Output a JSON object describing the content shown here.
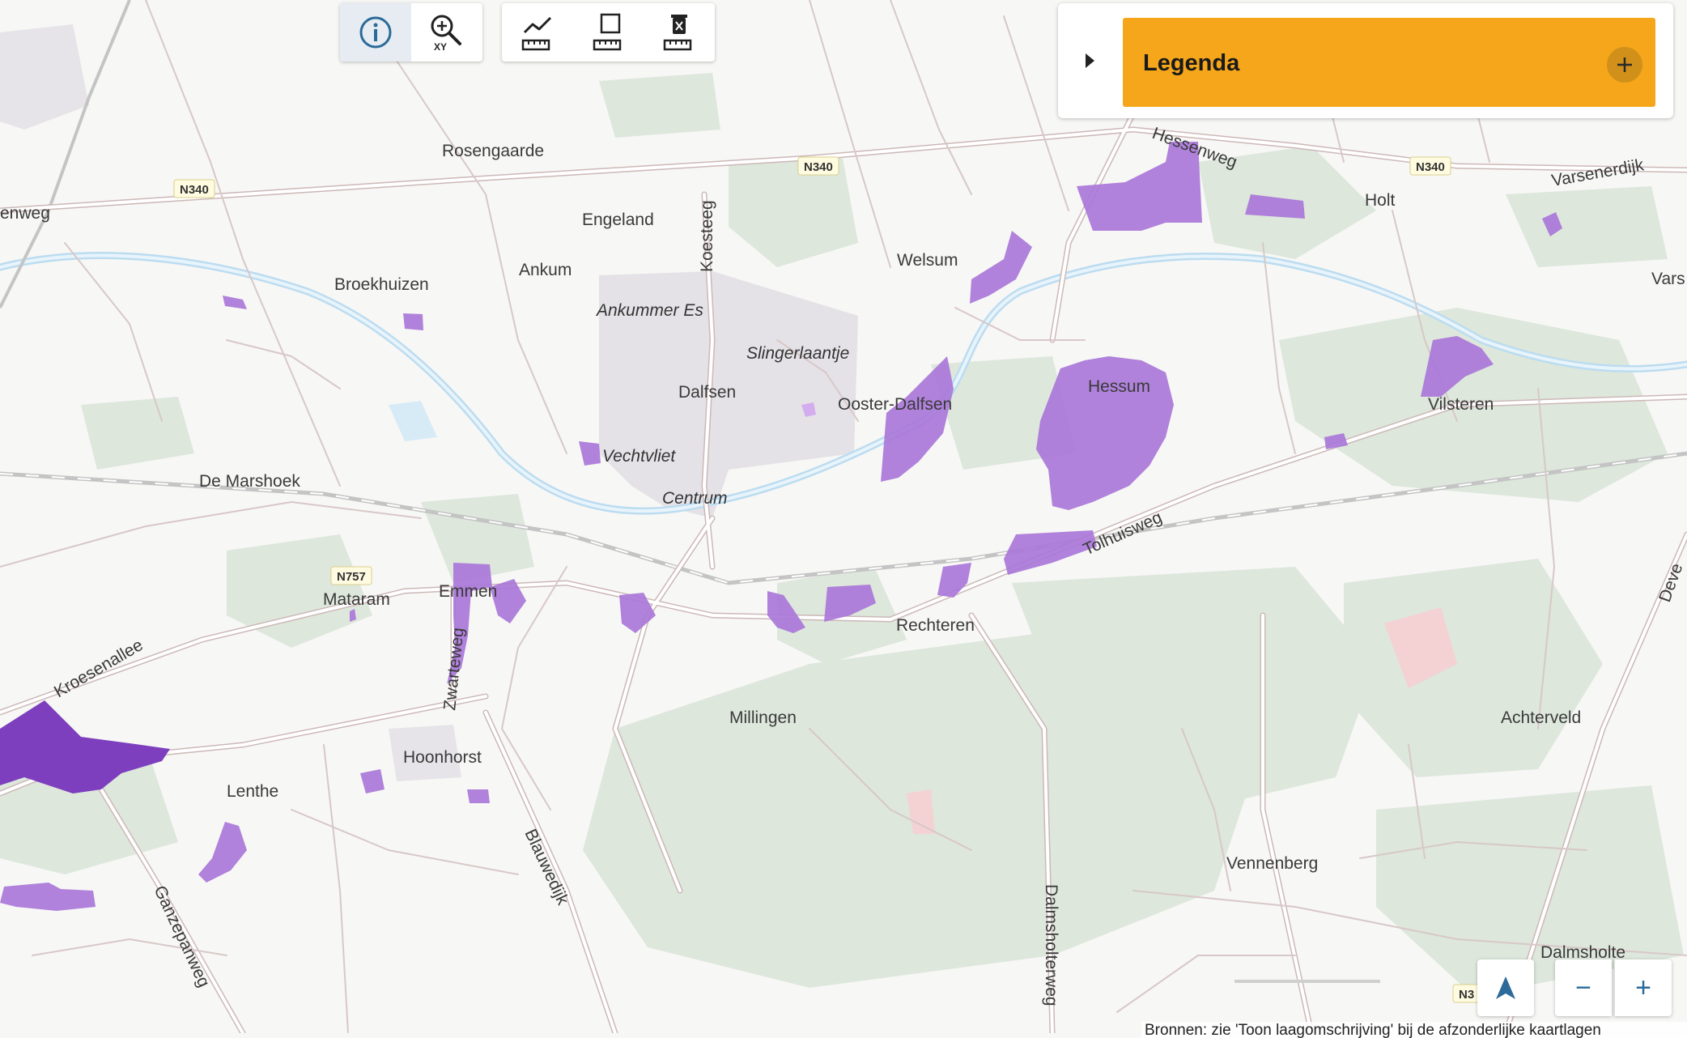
{
  "toolbar": {
    "tools": [
      {
        "name": "info-tool",
        "icon": "info-icon",
        "active": true
      },
      {
        "name": "zoom-xy-tool",
        "icon": "zoom-xy-icon",
        "icon_text": "XY"
      },
      {
        "name": "measure-line-tool",
        "icon": "measure-line-icon"
      },
      {
        "name": "measure-area-tool",
        "icon": "measure-area-icon"
      },
      {
        "name": "clear-measure-tool",
        "icon": "trash-ruler-icon"
      }
    ]
  },
  "legend": {
    "title": "Legenda",
    "toggle_icon": "caret-right-icon",
    "expand_icon": "plus-icon",
    "accent_color": "#f5a61a"
  },
  "controls": {
    "locate_icon": "navigation-arrow-icon",
    "zoom_out_label": "−",
    "zoom_in_label": "+",
    "accent_color": "#2c6a9a"
  },
  "attribution": "Bronnen: zie 'Toon laagomschrijving' bij de afzonderlijke kaartlagen",
  "map": {
    "overlay_color": "#a977d8",
    "overlay_dark_color": "#7d3fbe",
    "place_labels": [
      "Rosengaarde",
      "Engeland",
      "Ankum",
      "Broekhuizen",
      "Dalfsen",
      "De Marshoek",
      "Mataram",
      "Emmen",
      "Welsum",
      "Ooster-Dalfsen",
      "Hessum",
      "Rechteren",
      "Vilsteren",
      "Holt",
      "Millingen",
      "Hoonhorst",
      "Lenthe",
      "Achterveld",
      "Vennenberg",
      "Dalmsholte",
      "Vars"
    ],
    "district_labels": [
      "Ankummer Es",
      "Slingerlaantje",
      "Vechtvliet",
      "Centrum"
    ],
    "road_labels": [
      "Koesteeg",
      "Hessenweg",
      "Varsenerdijk",
      "enweg",
      "Tolhuisweg",
      "Kroesenallee",
      "Zwarteweg",
      "Blauwedijk",
      "Ganzepanweg",
      "Dalmsholterweg",
      "Deve"
    ],
    "shields": [
      "N340",
      "N340",
      "N340",
      "N757",
      "N3"
    ]
  }
}
